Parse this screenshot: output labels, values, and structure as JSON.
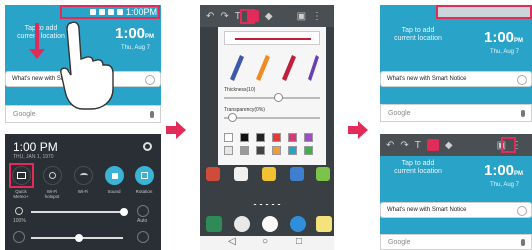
{
  "panel1": {
    "status_time": "1:00PM",
    "clock_time": "1:00",
    "clock_suffix": "PM",
    "date_text": "Thu, Aug 7",
    "tap_line1": "Tap to add",
    "tap_line2": "current location",
    "news_text": "What's new with Smar",
    "google_text": "Google"
  },
  "panel2": {
    "time": "1:00 PM",
    "date": "THU, JAN 1, 1970",
    "quick_tiles": [
      {
        "label1": "Quick",
        "label2": "Memo+"
      },
      {
        "label1": "Wi-Fi",
        "label2": "hotspot"
      },
      {
        "label1": "Wi-Fi",
        "label2": ""
      },
      {
        "label1": "Sound",
        "label2": ""
      },
      {
        "label1": "Rotation",
        "label2": ""
      }
    ],
    "brightness_pct": "100%",
    "auto_label": "Auto"
  },
  "panel3": {
    "thickness_label": "Thickness(10)",
    "transparency_label": "Transparency(0%)",
    "thickness_value": 0.56,
    "transparency_value": 0.08,
    "palette_row1": [
      "#ffffff",
      "#111111",
      "#222222",
      "#e23b3b",
      "#d63a7a",
      "#9b4fc3"
    ],
    "palette_row2": [
      "#e7e7e7",
      "#9a9a9a",
      "#444444",
      "#f39a3a",
      "#2aa3c8",
      "#3cb24c"
    ]
  },
  "panel4": {
    "clock_time": "1:00",
    "clock_suffix": "PM",
    "date_text": "Thu, Aug 7",
    "tap_line1": "Tap to add",
    "tap_line2": "current location",
    "news_text": "What's new with Smart Notice",
    "google_text": "Google"
  },
  "panel5": {
    "clock_time": "1:00",
    "clock_suffix": "PM",
    "date_text": "Thu, Aug 7",
    "tap_line1": "Tap to add",
    "tap_line2": "current location",
    "news_text": "What's new with Smart Notice",
    "google_text": "Google"
  },
  "colors": {
    "accent_teal": "#2aa3c8",
    "highlight_red": "#e32b5a",
    "dark_panel": "#2a2f35"
  }
}
